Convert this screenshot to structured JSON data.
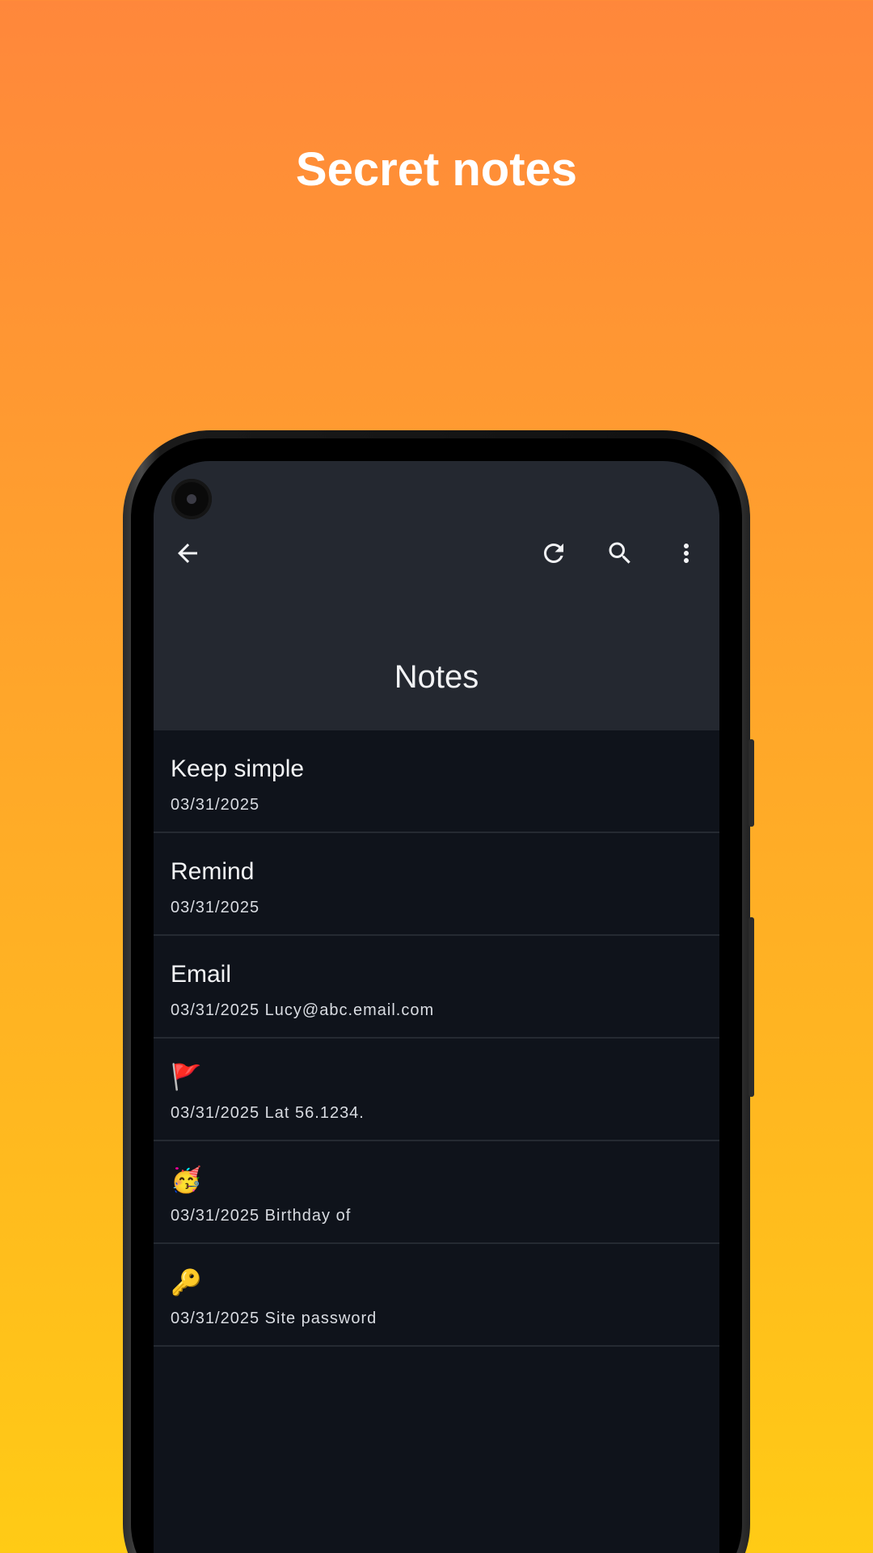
{
  "headline": "Secret notes",
  "colors": {
    "background_top": "#ff873b",
    "background_bottom": "#ffcb15",
    "appbar": "#242830",
    "list_background": "#0f131b",
    "divider": "#252a32",
    "text_primary": "#f2f3f5"
  },
  "appbar": {
    "title": "Notes",
    "icons": {
      "back": "arrow-back-icon",
      "refresh": "refresh-icon",
      "search": "search-icon",
      "menu": "more-vert-icon"
    }
  },
  "notes": [
    {
      "title": "Keep simple",
      "subtitle": "03/31/2025"
    },
    {
      "title": "Remind",
      "subtitle": "03/31/2025"
    },
    {
      "title": "Email",
      "subtitle": "03/31/2025 Lucy@abc.email.com"
    },
    {
      "title": "🚩",
      "subtitle": "03/31/2025 Lat 56.1234."
    },
    {
      "title": "🥳",
      "subtitle": "03/31/2025 Birthday of"
    },
    {
      "title": "🔑",
      "subtitle": "03/31/2025 Site password"
    }
  ]
}
